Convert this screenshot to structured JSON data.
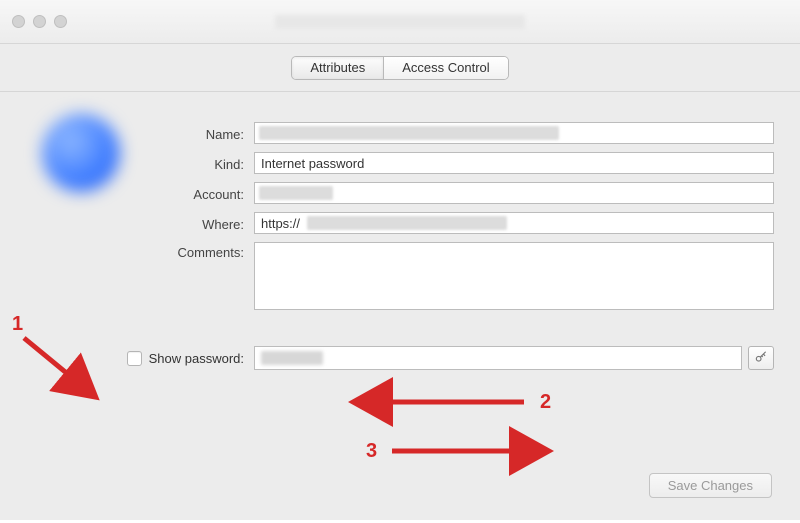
{
  "window": {
    "title_obscured": true
  },
  "tabs": {
    "attributes": "Attributes",
    "access_control": "Access Control",
    "selected": "Attributes"
  },
  "form": {
    "name": {
      "label": "Name:",
      "value_obscured": true
    },
    "kind": {
      "label": "Kind:",
      "value": "Internet password"
    },
    "account": {
      "label": "Account:",
      "value_obscured": true
    },
    "where": {
      "label": "Where:",
      "value_prefix": "https://",
      "value_obscured_suffix": true
    },
    "comments": {
      "label": "Comments:",
      "value": ""
    },
    "show_password": {
      "label": "Show password:",
      "checked": false,
      "value_obscured": true
    }
  },
  "buttons": {
    "save": "Save Changes"
  },
  "annotations": {
    "n1": "1",
    "n2": "2",
    "n3": "3"
  },
  "colors": {
    "accent_red": "#d62828"
  }
}
